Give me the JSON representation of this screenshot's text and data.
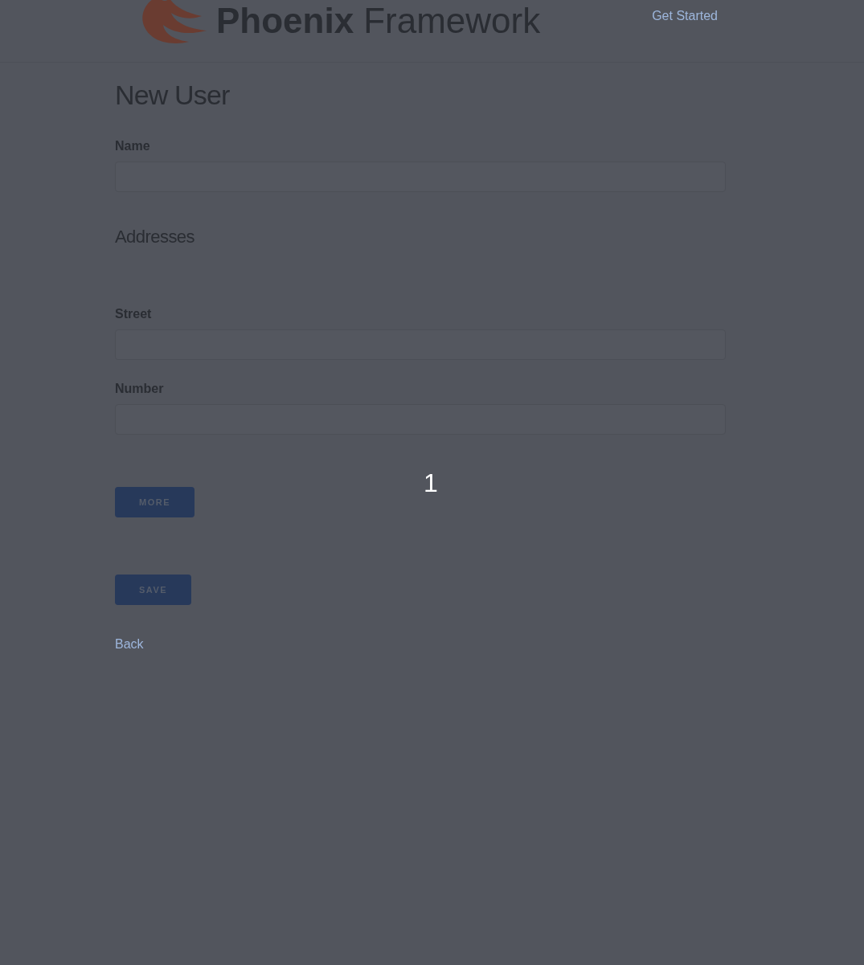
{
  "header": {
    "logo": {
      "bold": "Phoenix",
      "light": "Framework"
    },
    "nav_link": "Get Started"
  },
  "title": "New User",
  "fields": [
    {
      "label": "Name"
    }
  ],
  "section_title": "Addresses",
  "address_fields": [
    {
      "label": "Street"
    },
    {
      "label": "Number"
    }
  ],
  "more_button": "MORE",
  "save_button": "SAVE",
  "back_link": "Back",
  "overlay_counter": "1"
}
